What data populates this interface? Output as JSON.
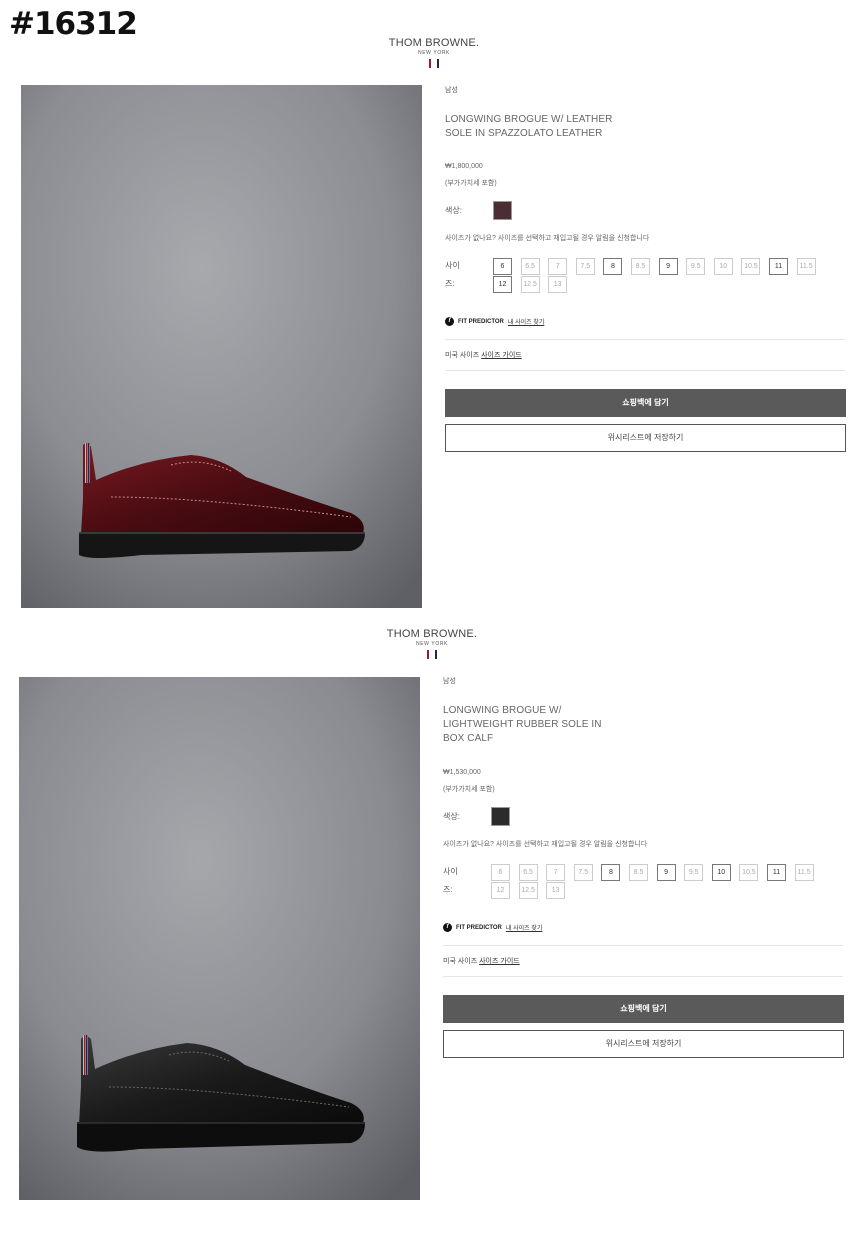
{
  "page_code": "#16312",
  "brand": {
    "name": "THOM BROWNE.",
    "sub": "NEW YORK",
    "stripe_colors": [
      "#9b1b2c",
      "#ffffff",
      "#1d2a55"
    ]
  },
  "products": [
    {
      "category": "남성",
      "title_lines": [
        "LONGWING BROGUE W/ LEATHER",
        "SOLE IN SPAZZOLATO LEATHER"
      ],
      "price": "₩1,800,000",
      "vat": "(부가가치세 포함)",
      "color_label": "색상:",
      "swatch_color": "#4a2e33",
      "size_notice": "사이즈가 없나요? 사이즈를 선택하고 재입고될 경우 알림을 신청합니다",
      "size_label": "사이즈:",
      "sizes": [
        {
          "label": "6",
          "available": true
        },
        {
          "label": "6.5",
          "available": false
        },
        {
          "label": "7",
          "available": false
        },
        {
          "label": "7.5",
          "available": false
        },
        {
          "label": "8",
          "available": true
        },
        {
          "label": "8.5",
          "available": false
        },
        {
          "label": "9",
          "available": true
        },
        {
          "label": "9.5",
          "available": false
        },
        {
          "label": "10",
          "available": false
        },
        {
          "label": "10.5",
          "available": false
        },
        {
          "label": "11",
          "available": true
        },
        {
          "label": "11.5",
          "available": false
        },
        {
          "label": "12",
          "available": true
        },
        {
          "label": "12.5",
          "available": false
        },
        {
          "label": "13",
          "available": false
        }
      ],
      "fit_predictor": "FIT PREDICTOR",
      "fit_link": "내 사이즈 찾기",
      "guide_prefix": "미국 사이즈",
      "guide_link": "사이즈 가이드",
      "add_to_bag": "쇼핑백에 담기",
      "wishlist": "위시리스트에 저장하기",
      "shoe_color": "#5a1016"
    },
    {
      "category": "남성",
      "title_lines": [
        "LONGWING BROGUE W/",
        "LIGHTWEIGHT RUBBER SOLE IN",
        "BOX CALF"
      ],
      "price": "₩1,530,000",
      "vat": "(부가가치세 포함)",
      "color_label": "색상:",
      "swatch_color": "#2b2b2e",
      "size_notice": "사이즈가 없나요? 사이즈를 선택하고 재입고될 경우 알림을 신청합니다",
      "size_label": "사이즈:",
      "sizes": [
        {
          "label": "6",
          "available": false
        },
        {
          "label": "6.5",
          "available": false
        },
        {
          "label": "7",
          "available": false
        },
        {
          "label": "7.5",
          "available": false
        },
        {
          "label": "8",
          "available": true
        },
        {
          "label": "8.5",
          "available": false
        },
        {
          "label": "9",
          "available": true
        },
        {
          "label": "9.5",
          "available": false
        },
        {
          "label": "10",
          "available": true
        },
        {
          "label": "10.5",
          "available": false
        },
        {
          "label": "11",
          "available": true
        },
        {
          "label": "11.5",
          "available": false
        },
        {
          "label": "12",
          "available": false
        },
        {
          "label": "12.5",
          "available": false
        },
        {
          "label": "13",
          "available": false
        }
      ],
      "fit_predictor": "FIT PREDICTOR",
      "fit_link": "내 사이즈 찾기",
      "guide_prefix": "미국 사이즈",
      "guide_link": "사이즈 가이드",
      "add_to_bag": "쇼핑백에 담기",
      "wishlist": "위시리스트에 저장하기",
      "shoe_color": "#151515"
    }
  ]
}
